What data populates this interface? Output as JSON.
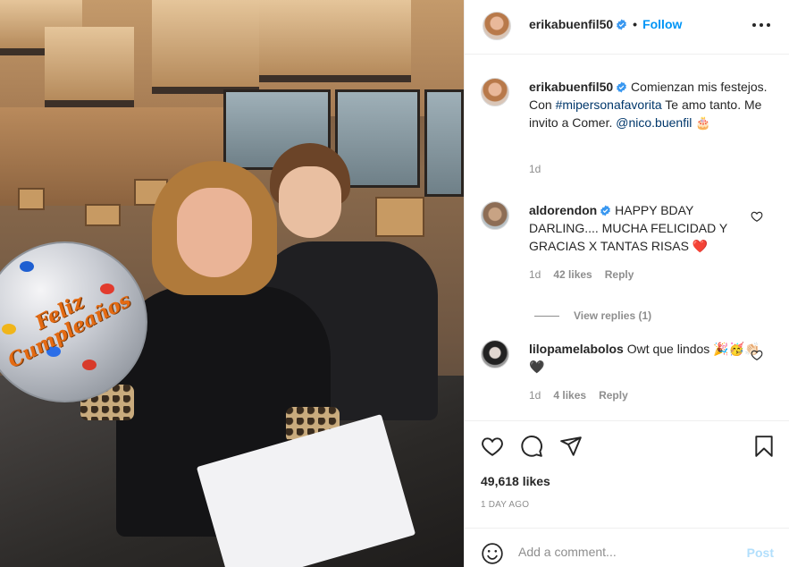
{
  "header": {
    "username": "erikabuenfil50",
    "separator": "•",
    "follow_label": "Follow",
    "more_icon": "more-horizontal-icon"
  },
  "photo": {
    "balloon_text": "Feliz Cumpleaños"
  },
  "caption": {
    "username": "erikabuenfil50",
    "text_1": "Comienzan mis festejos. Con",
    "hashtag": "#mipersonafavorita",
    "text_2": "Te amo tanto. Me invito a Comer.",
    "mention": "@nico.buenfil",
    "emoji": "🎂",
    "time": "1d"
  },
  "comments": [
    {
      "username": "aldorendon",
      "verified": true,
      "text": "HAPPY BDAY DARLING.... MUCHA FELICIDAD Y GRACIAS X TANTAS RISAS",
      "emoji": "❤️",
      "time": "1d",
      "likes": "42 likes",
      "reply_label": "Reply"
    },
    {
      "username": "lilopamelabolos",
      "verified": false,
      "text": "Owt que lindos",
      "emoji": "🎉🥳👏🏻🖤",
      "time": "1d",
      "likes": "4 likes",
      "reply_label": "Reply"
    }
  ],
  "view_replies": "View replies (1)",
  "actions": {
    "like_icon": "heart-icon",
    "comment_icon": "comment-icon",
    "share_icon": "share-icon",
    "save_icon": "bookmark-icon",
    "likes_count": "49,618 likes",
    "date": "1 DAY AGO"
  },
  "add_comment": {
    "placeholder": "Add a comment...",
    "post_label": "Post",
    "emoji_icon": "smiley-icon"
  },
  "colors": {
    "link_blue": "#0095f6",
    "hashtag": "#00376b",
    "muted": "#8e8e8e",
    "post_disabled": "#b2dffc",
    "heart_red": "#ed4956"
  }
}
